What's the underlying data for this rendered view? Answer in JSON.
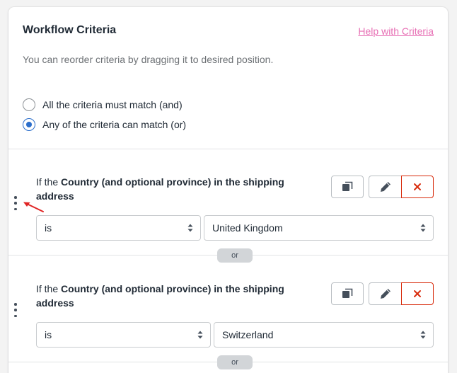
{
  "card": {
    "title": "Workflow Criteria",
    "help_link": "Help with Criteria",
    "subtext": "You can reorder criteria by dragging it to desired position."
  },
  "match_mode": {
    "options": [
      {
        "label": "All the criteria must match (and)",
        "checked": false
      },
      {
        "label": "Any of the criteria can match (or)",
        "checked": true
      }
    ]
  },
  "criteria": [
    {
      "prefix": "If the",
      "subject": "Country (and optional province) in the shipping address",
      "operator": "is",
      "value": "United Kingdom",
      "join": "or"
    },
    {
      "prefix": "If the",
      "subject": "Country (and optional province) in the shipping address",
      "operator": "is",
      "value": "Switzerland",
      "join": "or"
    }
  ],
  "icons": {
    "drag": "drag-handle-icon",
    "duplicate": "duplicate-icon",
    "edit": "pencil-icon",
    "remove": "close-icon",
    "select": "select-chevron-icon",
    "pointer": "red-arrow-annotation"
  },
  "colors": {
    "link": "#e76fb4",
    "radio_selected": "#2c6ecb",
    "remove": "#d82c0d",
    "annotation": "#e02424"
  }
}
